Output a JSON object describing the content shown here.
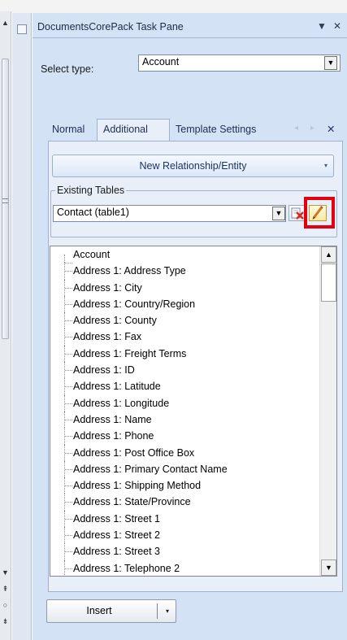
{
  "pane": {
    "title": "DocumentsCorePack Task Pane",
    "pin_glyph": "▼",
    "close_glyph": "✕"
  },
  "select_type": {
    "label": "Select type:",
    "value": "Account"
  },
  "tabs": [
    {
      "label": "Normal",
      "active": false
    },
    {
      "label": "Additional",
      "active": true
    },
    {
      "label": "Template Settings",
      "active": false
    }
  ],
  "tab_nav": {
    "prev": "◂",
    "next": "▸",
    "close": "✕"
  },
  "new_relationship_button": {
    "label": "New Relationship/Entity",
    "arrow": "▾"
  },
  "existing_tables": {
    "legend": "Existing Tables",
    "value": "Contact  (table1)"
  },
  "fields": [
    "Account",
    "Address 1: Address Type",
    "Address 1: City",
    "Address 1: Country/Region",
    "Address 1: County",
    "Address 1: Fax",
    "Address 1: Freight Terms",
    "Address 1: ID",
    "Address 1: Latitude",
    "Address 1: Longitude",
    "Address 1: Name",
    "Address 1: Phone",
    "Address 1: Post Office Box",
    "Address 1: Primary Contact Name",
    "Address 1: Shipping Method",
    "Address 1: State/Province",
    "Address 1: Street 1",
    "Address 1: Street 2",
    "Address 1: Street 3",
    "Address 1: Telephone 2"
  ],
  "insert_button": {
    "label": "Insert",
    "arrow": "▾"
  },
  "icons": {
    "delete": "delete-table-icon",
    "edit": "edit-pencil-icon"
  },
  "colors": {
    "pane_bg": "#d4e2f6",
    "tab_content_bg": "#e9eff9",
    "highlight": "#e3000f"
  }
}
